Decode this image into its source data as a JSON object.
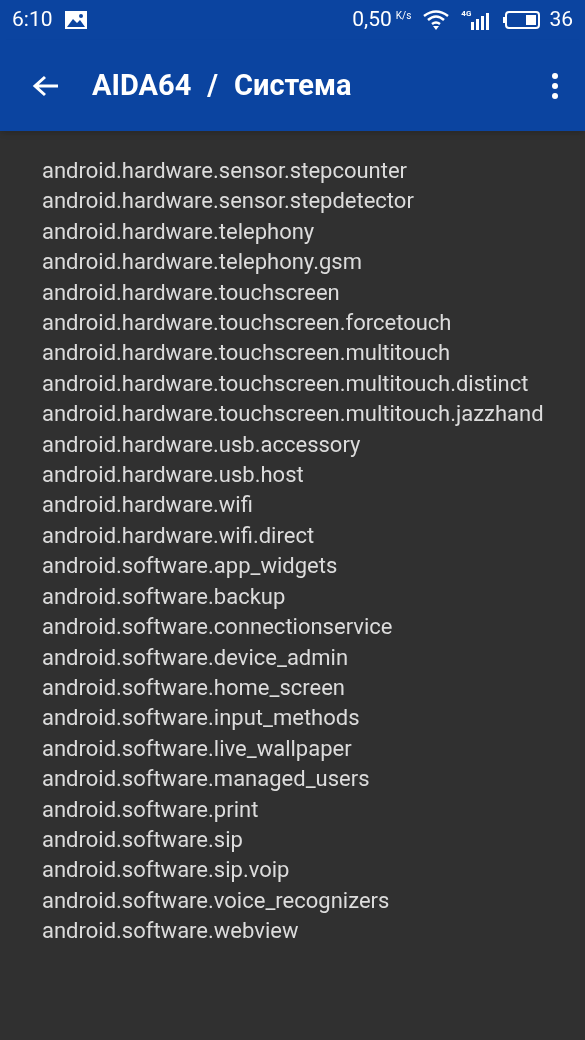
{
  "status_bar": {
    "time": "6:10",
    "speed": "0,50",
    "speed_unit": "K/s",
    "network": "4G",
    "battery": "36"
  },
  "app_bar": {
    "title": "AIDA64",
    "separator": "/",
    "subtitle": "Система"
  },
  "items": [
    "android.hardware.sensor.stepcounter",
    "android.hardware.sensor.stepdetector",
    "android.hardware.telephony",
    "android.hardware.telephony.gsm",
    "android.hardware.touchscreen",
    "android.hardware.touchscreen.forcetouch",
    "android.hardware.touchscreen.multitouch",
    "android.hardware.touchscreen.multitouch.distinct",
    "android.hardware.touchscreen.multitouch.jazzhand",
    "android.hardware.usb.accessory",
    "android.hardware.usb.host",
    "android.hardware.wifi",
    "android.hardware.wifi.direct",
    "android.software.app_widgets",
    "android.software.backup",
    "android.software.connectionservice",
    "android.software.device_admin",
    "android.software.home_screen",
    "android.software.input_methods",
    "android.software.live_wallpaper",
    "android.software.managed_users",
    "android.software.print",
    "android.software.sip",
    "android.software.sip.voip",
    "android.software.voice_recognizers",
    "android.software.webview"
  ]
}
